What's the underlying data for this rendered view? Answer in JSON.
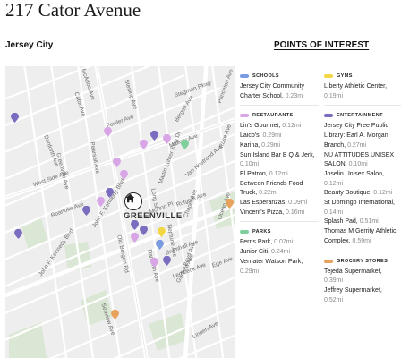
{
  "header": {
    "address": "217 Cator Avenue",
    "city": "Jersey City",
    "poi_heading": "POINTS OF INTEREST"
  },
  "map": {
    "area_label": "GREENVILLE",
    "streets": [
      "Danforth Ave",
      "John F. Kennedy Blvd",
      "John F. Kennedy Blvd",
      "Bergen Ave",
      "Garfield Ave",
      "Old Bergen Rd",
      "Danforth Ave",
      "Cator Ave",
      "Fowler Ave",
      "Sterling Ave",
      "McAdoo Ave",
      "Stegman Pkwy",
      "Mallory Ave",
      "Greenville Ave",
      "Roanoke Ave",
      "Martin Luther King Dr",
      "Van Nostrand Ave",
      "Long St",
      "Rose Ave",
      "Chapel Ave",
      "Neptune Ave",
      "Princeton Ave",
      "Ocean Ave",
      "Lembeck Ave",
      "Bramhall Ave",
      "Boyd Ave",
      "Linden Ave",
      "Pearsall Ave",
      "Rutgers Ave",
      "Ege Ave",
      "Morton Pl",
      "West Side Ave",
      "Seaview Ave"
    ],
    "home_icon": "house-icon"
  },
  "categories": {
    "schools": {
      "label": "SCHOOLS",
      "color": "#7b9be0",
      "items": [
        {
          "name": "Jersey City Community Charter School,",
          "dist": "0.23mi"
        }
      ]
    },
    "restaurants": {
      "label": "RESTAURANTS",
      "color": "#d8a6e6",
      "items": [
        {
          "name": "Lin's Gourmet,",
          "dist": "0.12mi"
        },
        {
          "name": "Laico's,",
          "dist": "0.29mi"
        },
        {
          "name": "Karina,",
          "dist": "0.29mi"
        },
        {
          "name": "Sun Island Bar B Q & Jerk,",
          "dist": "0.10mi"
        },
        {
          "name": "El Patron,",
          "dist": "0.12mi"
        },
        {
          "name": "Between Friends Food Truck,",
          "dist": "0.22mi"
        },
        {
          "name": "Las Esperanzas,",
          "dist": "0.09mi"
        },
        {
          "name": "Vincent's Pizza,",
          "dist": "0.16mi"
        }
      ]
    },
    "parks": {
      "label": "PARKS",
      "color": "#7fcf9d",
      "items": [
        {
          "name": "Ferris Park,",
          "dist": "0.07mi"
        },
        {
          "name": "Junior Citi,",
          "dist": "0.24mi"
        },
        {
          "name": "Vernater Watson Park,",
          "dist": "0.29mi"
        }
      ]
    },
    "gyms": {
      "label": "GYMS",
      "color": "#f2d644",
      "items": [
        {
          "name": "Liberty Athletic Center,",
          "dist": "0.19mi"
        }
      ]
    },
    "entertainment": {
      "label": "ENTERTAINMENT",
      "color": "#7b6cbf",
      "items": [
        {
          "name": "Jersey City Free Public Library: Earl A. Morgan Branch,",
          "dist": "0.27mi"
        },
        {
          "name": "NU ATTITUDES UNISEX SALON,",
          "dist": "0.10mi"
        },
        {
          "name": "Joselin Unisex Salon,",
          "dist": "0.12mi"
        },
        {
          "name": "Beauty Boutique,",
          "dist": "0.12mi"
        },
        {
          "name": "St Domingo International,",
          "dist": "0.14mi"
        },
        {
          "name": "Splash Pad,",
          "dist": "0.51mi"
        },
        {
          "name": "Thomas M Gerrity Athletic Complex,",
          "dist": "0.59mi"
        }
      ]
    },
    "grocery": {
      "label": "GROCERY STORES",
      "color": "#e9a25c",
      "items": [
        {
          "name": "Tejeda Supermarket,",
          "dist": "0.39mi"
        },
        {
          "name": "Jeffrey Supermarket,",
          "dist": "0.52mi"
        }
      ]
    }
  }
}
